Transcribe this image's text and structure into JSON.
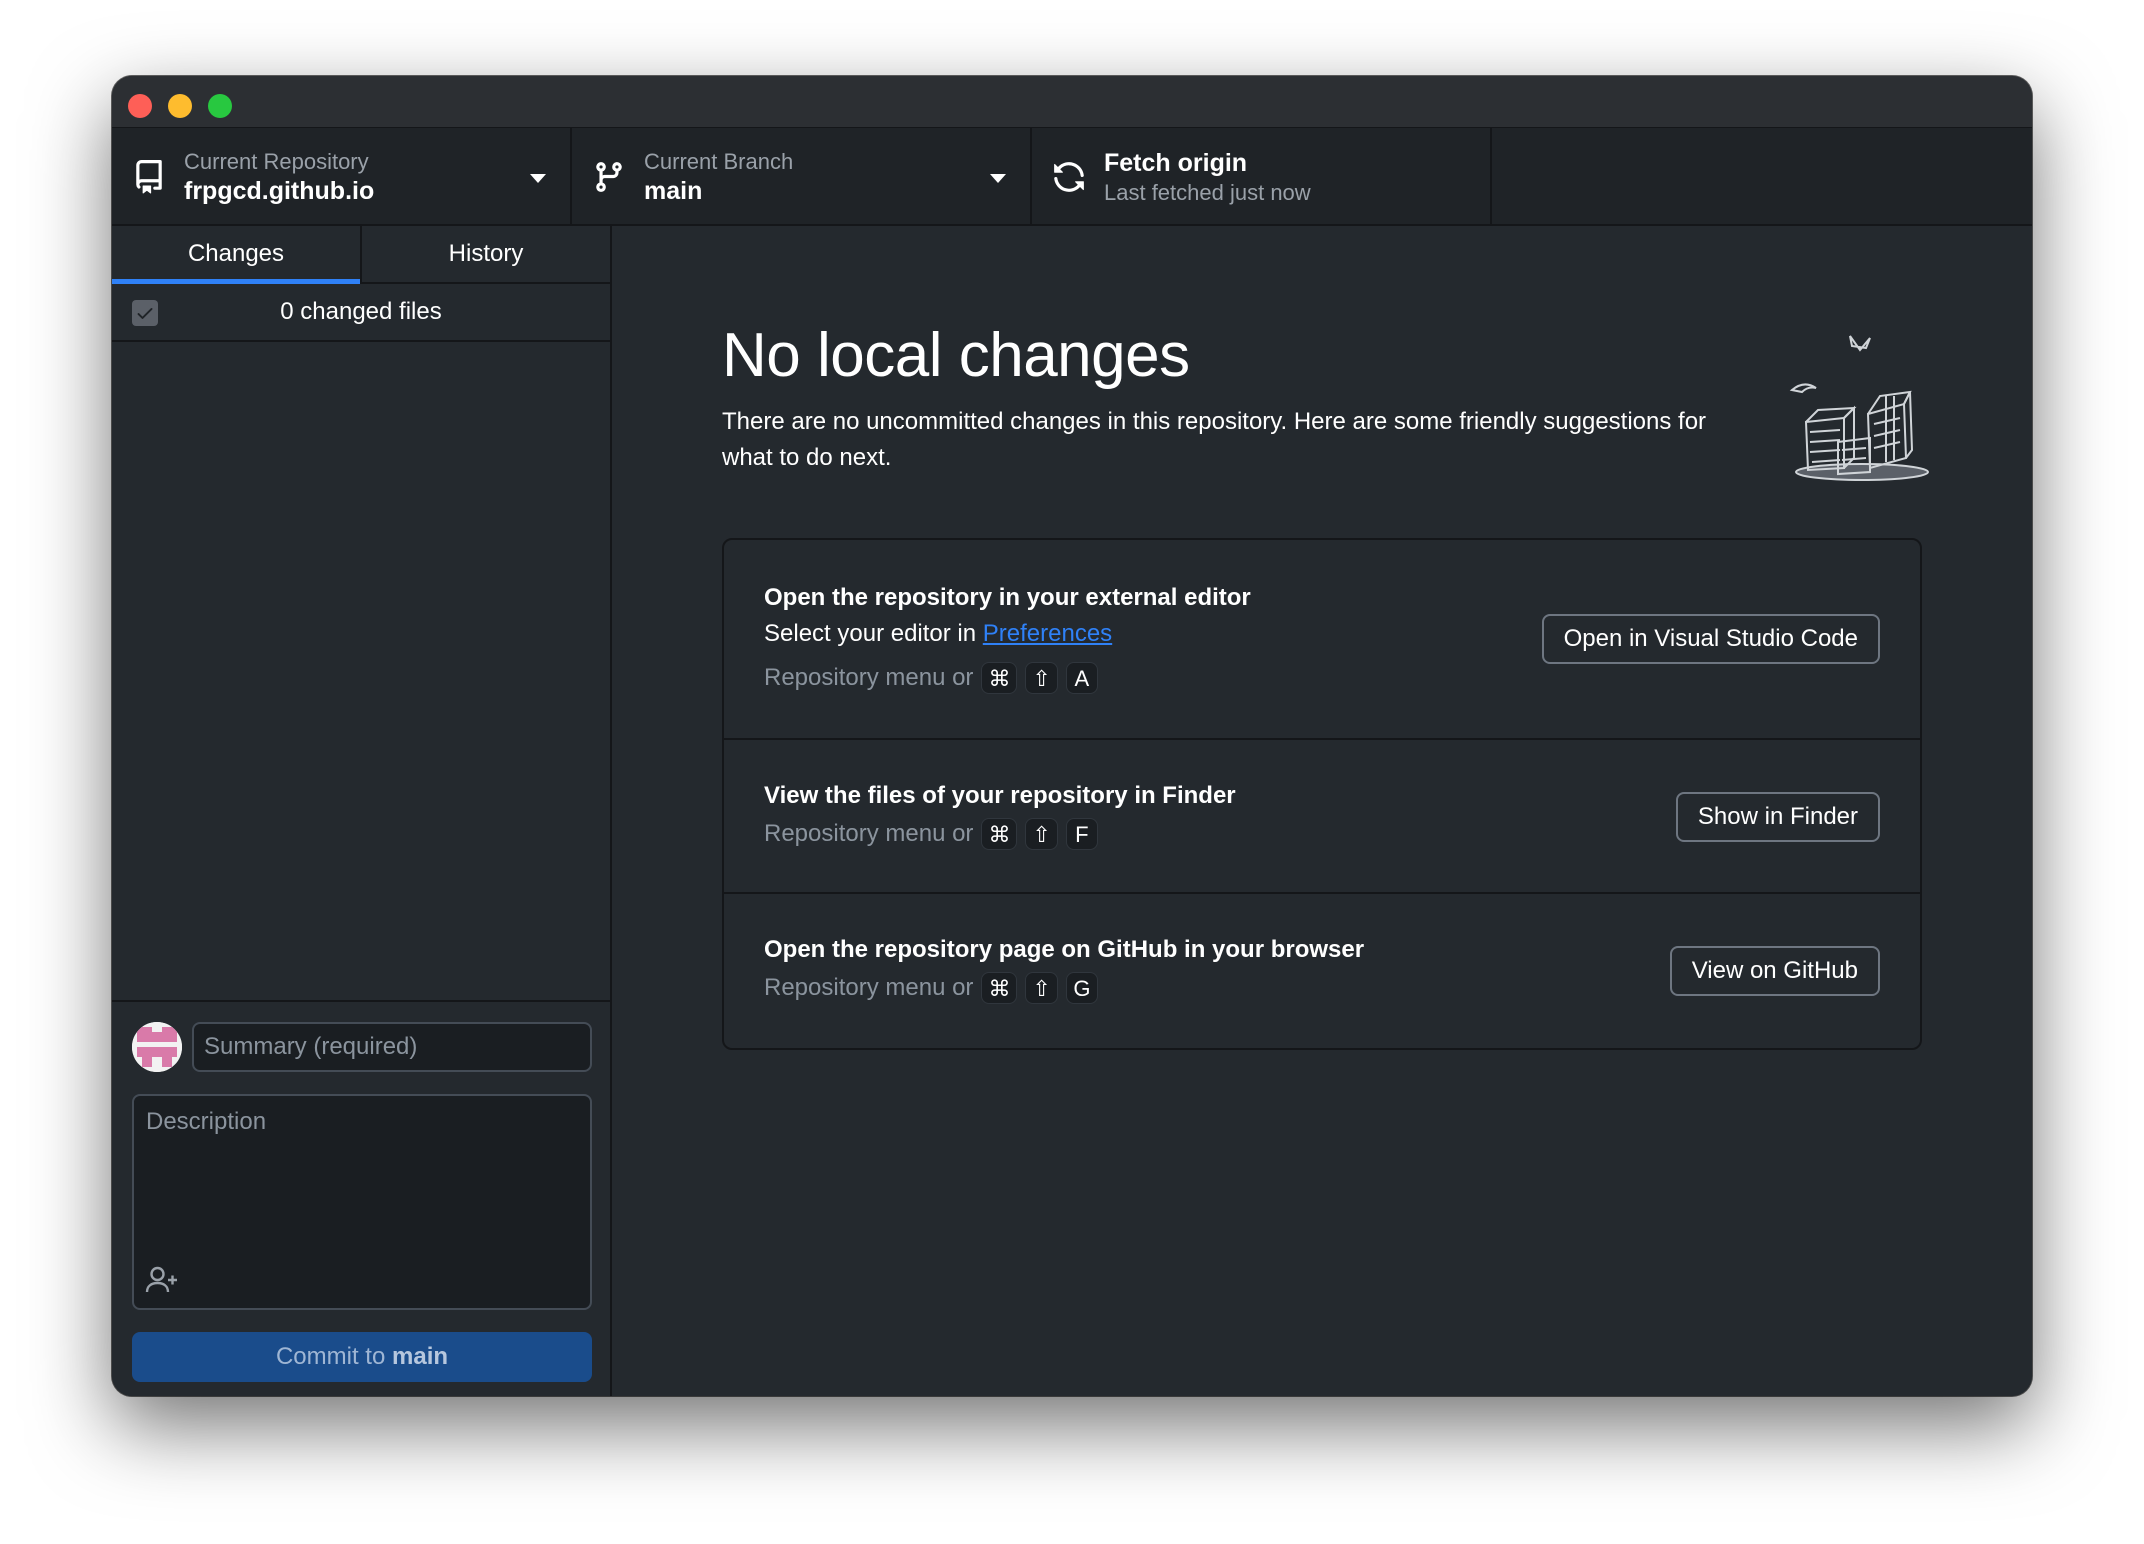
{
  "toolbar": {
    "repository": {
      "label": "Current Repository",
      "value": "frpgcd.github.io"
    },
    "branch": {
      "label": "Current Branch",
      "value": "main"
    },
    "fetch": {
      "title": "Fetch origin",
      "subtitle": "Last fetched just now"
    }
  },
  "sidebar": {
    "tabs": [
      {
        "label": "Changes",
        "active": true
      },
      {
        "label": "History",
        "active": false
      }
    ],
    "changed_files": "0 changed files",
    "summary_placeholder": "Summary (required)",
    "description_placeholder": "Description",
    "commit_prefix": "Commit to",
    "commit_branch": "main"
  },
  "main": {
    "title": "No local changes",
    "description": "There are no uncommitted changes in this repository. Here are some friendly suggestions for what to do next.",
    "actions": [
      {
        "title": "Open the repository in your external editor",
        "subtitle_prefix": "Select your editor in",
        "subtitle_link": "Preferences",
        "shortcut_prefix": "Repository menu or",
        "keys": [
          "⌘",
          "⇧",
          "A"
        ],
        "button": "Open in Visual Studio Code"
      },
      {
        "title": "View the files of your repository in Finder",
        "shortcut_prefix": "Repository menu or",
        "keys": [
          "⌘",
          "⇧",
          "F"
        ],
        "button": "Show in Finder"
      },
      {
        "title": "Open the repository page on GitHub in your browser",
        "shortcut_prefix": "Repository menu or",
        "keys": [
          "⌘",
          "⇧",
          "G"
        ],
        "button": "View on GitHub"
      }
    ]
  },
  "colors": {
    "accent": "#2f81f7",
    "background": "#24292e",
    "toolbar": "#1f2327",
    "commit_button": "#1a4c8b"
  },
  "icons": {
    "repository": "repo-icon",
    "branch": "git-branch-icon",
    "fetch": "sync-icon",
    "coauthor": "person-add-icon"
  }
}
